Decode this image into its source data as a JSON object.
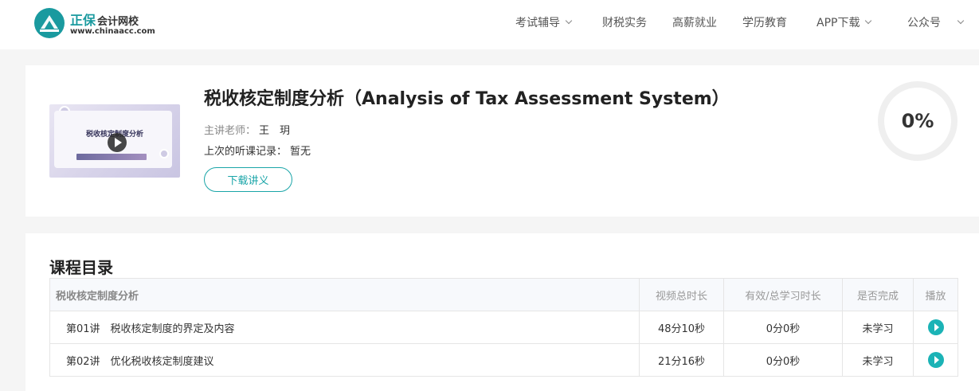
{
  "header": {
    "logo_main": "正保",
    "logo_sub": "会计网校",
    "logo_url": "www.chinaacc.com",
    "nav": [
      {
        "label": "考试辅导",
        "has_dropdown": true
      },
      {
        "label": "财税实务",
        "has_dropdown": false
      },
      {
        "label": "高薪就业",
        "has_dropdown": false
      },
      {
        "label": "学历教育",
        "has_dropdown": false
      },
      {
        "label": "APP下载",
        "has_dropdown": true
      },
      {
        "label": "公众号",
        "has_dropdown": true
      }
    ]
  },
  "course": {
    "thumbnail_title": "税收核定制度分析",
    "title": "税收核定制度分析（Analysis of Tax Assessment System）",
    "teacher_label": "主讲老师：",
    "teacher_name": "王　玥",
    "last_record_label": "上次的听课记录：",
    "last_record_value": "暂无",
    "download_label": "下载讲义",
    "progress": "0%"
  },
  "catalog": {
    "heading": "课程目录",
    "columns": [
      "税收核定制度分析",
      "视频总时长",
      "有效/总学习时长",
      "是否完成",
      "播放"
    ],
    "rows": [
      {
        "no": "第01讲",
        "name": "税收核定制度的界定及内容",
        "duration": "48分10秒",
        "studied": "0分0秒",
        "status": "未学习"
      },
      {
        "no": "第02讲",
        "name": "优化税收核定制度建议",
        "duration": "21分16秒",
        "studied": "0分0秒",
        "status": "未学习"
      }
    ]
  },
  "colors": {
    "brand_teal": "#1aa5a8",
    "play_teal": "#1bb3b6",
    "page_bg": "#f5f5f5"
  },
  "icons": [
    "chinaacc-logo-icon",
    "chevron-down-icon",
    "play-icon"
  ]
}
